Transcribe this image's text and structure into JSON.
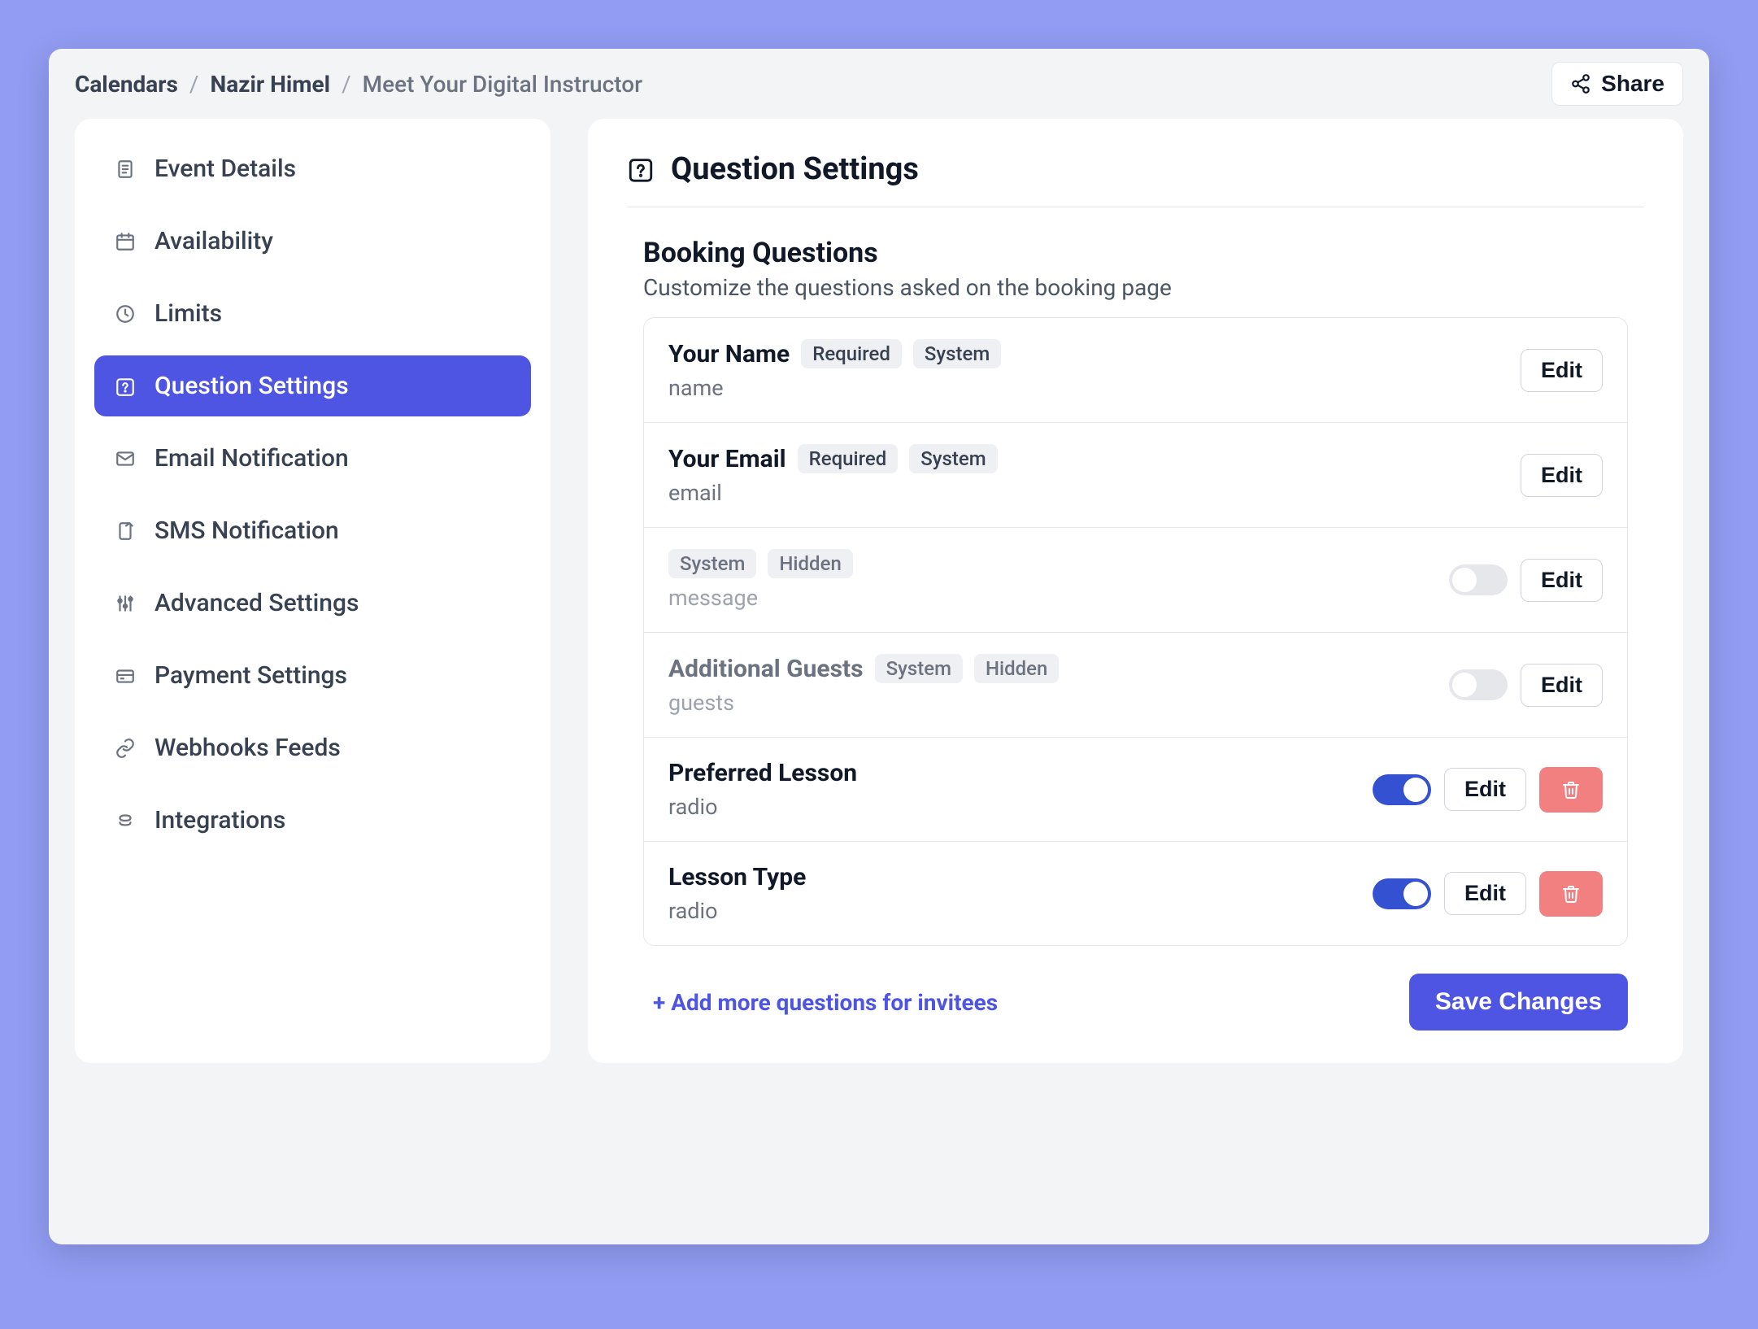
{
  "breadcrumb": {
    "root": "Calendars",
    "person": "Nazir Himel",
    "current": "Meet Your Digital Instructor"
  },
  "share_label": "Share",
  "sidebar": {
    "items": [
      {
        "label": "Event Details",
        "icon": "file-text-icon"
      },
      {
        "label": "Availability",
        "icon": "calendar-icon"
      },
      {
        "label": "Limits",
        "icon": "clock-icon"
      },
      {
        "label": "Question Settings",
        "icon": "calendar-question-icon"
      },
      {
        "label": "Email Notification",
        "icon": "mail-icon"
      },
      {
        "label": "SMS Notification",
        "icon": "mobile-icon"
      },
      {
        "label": "Advanced Settings",
        "icon": "sliders-icon"
      },
      {
        "label": "Payment Settings",
        "icon": "credit-card-icon"
      },
      {
        "label": "Webhooks Feeds",
        "icon": "link-icon"
      },
      {
        "label": "Integrations",
        "icon": "layers-icon"
      }
    ],
    "active_index": 3
  },
  "page": {
    "title": "Question Settings",
    "section_title": "Booking Questions",
    "section_subtitle": "Customize the questions asked on the booking page",
    "add_more_label": "+ Add more questions for invitees",
    "save_label": "Save Changes",
    "edit_label": "Edit",
    "badges": {
      "required": "Required",
      "system": "System",
      "hidden": "Hidden"
    },
    "questions": [
      {
        "title": "Your Name",
        "field": "name",
        "required": true,
        "system": true,
        "hidden": false,
        "has_toggle": false,
        "toggle_on": false,
        "deletable": false,
        "disabled": false
      },
      {
        "title": "Your Email",
        "field": "email",
        "required": true,
        "system": true,
        "hidden": false,
        "has_toggle": false,
        "toggle_on": false,
        "deletable": false,
        "disabled": false
      },
      {
        "title": "",
        "field": "message",
        "required": false,
        "system": true,
        "hidden": true,
        "has_toggle": true,
        "toggle_on": false,
        "deletable": false,
        "disabled": true
      },
      {
        "title": "Additional Guests",
        "field": "guests",
        "required": false,
        "system": true,
        "hidden": true,
        "has_toggle": true,
        "toggle_on": false,
        "deletable": false,
        "disabled": true
      },
      {
        "title": "Preferred Lesson",
        "field": "radio",
        "required": false,
        "system": false,
        "hidden": false,
        "has_toggle": true,
        "toggle_on": true,
        "deletable": true,
        "disabled": false
      },
      {
        "title": "Lesson Type",
        "field": "radio",
        "required": false,
        "system": false,
        "hidden": false,
        "has_toggle": true,
        "toggle_on": true,
        "deletable": true,
        "disabled": false
      }
    ]
  }
}
